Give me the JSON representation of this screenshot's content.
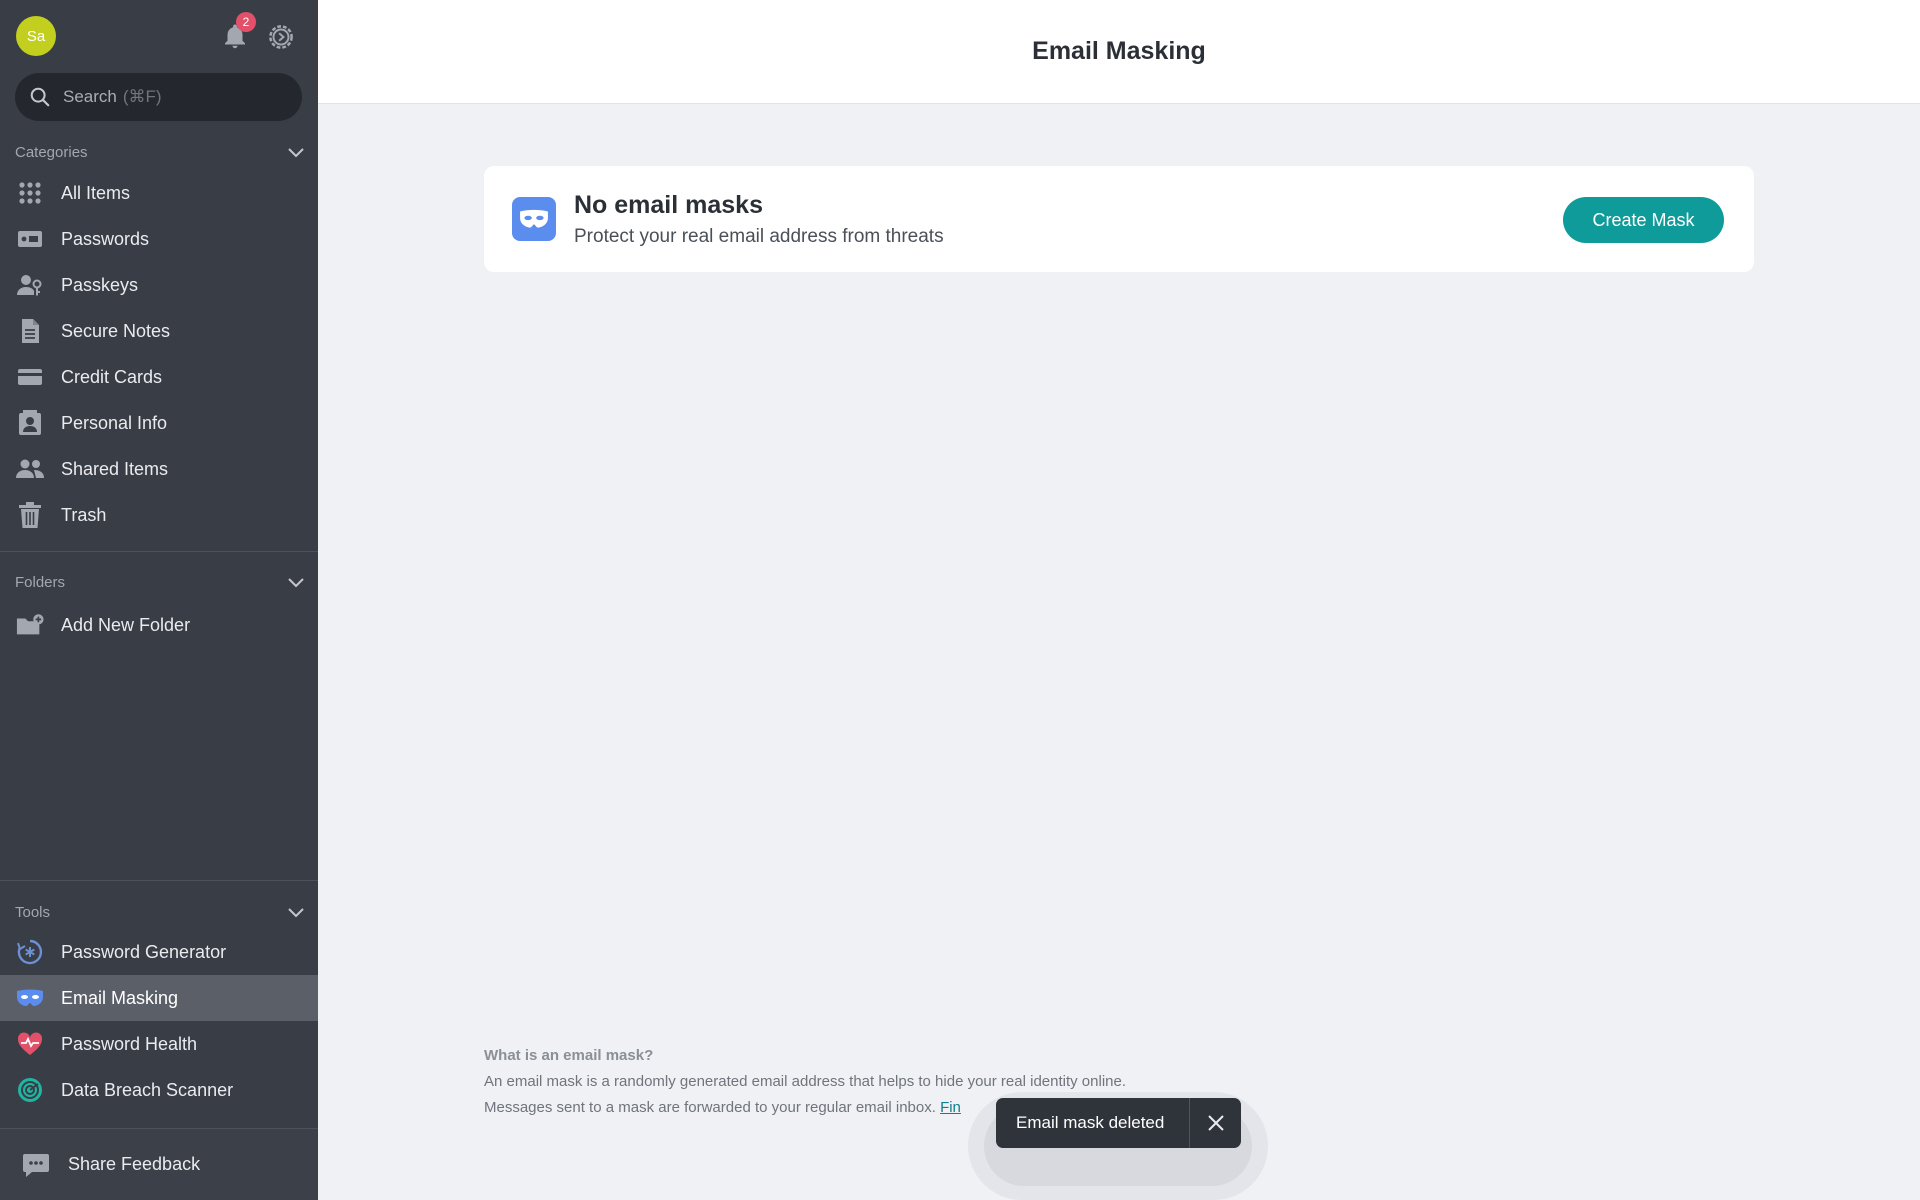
{
  "sidebar": {
    "avatar_initials": "Sa",
    "notification_count": "2",
    "search": {
      "placeholder": "Search",
      "shortcut": "(⌘F)"
    },
    "categories": {
      "heading": "Categories",
      "items": [
        {
          "label": "All Items",
          "icon": "grid-icon"
        },
        {
          "label": "Passwords",
          "icon": "password-icon"
        },
        {
          "label": "Passkeys",
          "icon": "passkey-icon"
        },
        {
          "label": "Secure Notes",
          "icon": "note-icon"
        },
        {
          "label": "Credit Cards",
          "icon": "credit-card-icon"
        },
        {
          "label": "Personal Info",
          "icon": "personal-info-icon"
        },
        {
          "label": "Shared Items",
          "icon": "shared-icon"
        },
        {
          "label": "Trash",
          "icon": "trash-icon"
        }
      ]
    },
    "folders": {
      "heading": "Folders",
      "add_label": "Add New Folder"
    },
    "tools": {
      "heading": "Tools",
      "items": [
        {
          "label": "Password Generator",
          "icon": "generator-icon",
          "color": "#6d8fd4"
        },
        {
          "label": "Email Masking",
          "icon": "mask-icon",
          "color": "#5b8def",
          "active": true
        },
        {
          "label": "Password Health",
          "icon": "heart-icon",
          "color": "#e2506a"
        },
        {
          "label": "Data Breach Scanner",
          "icon": "radar-icon",
          "color": "#1fb5a3"
        }
      ]
    },
    "feedback_label": "Share Feedback"
  },
  "header": {
    "title": "Email Masking"
  },
  "empty_state": {
    "title": "No email masks",
    "subtitle": "Protect your real email address from threats",
    "button_label": "Create Mask"
  },
  "info": {
    "question": "What is an email mask?",
    "line1": "An email mask is a randomly generated email address that helps to hide your real identity online.",
    "line2": "Messages sent to a mask are forwarded to your regular email inbox.",
    "link_text": "Fin"
  },
  "toast": {
    "message": "Email mask deleted"
  },
  "colors": {
    "accent": "#0f9b9a",
    "sidebar": "#393d45",
    "badge": "#e2506a"
  }
}
